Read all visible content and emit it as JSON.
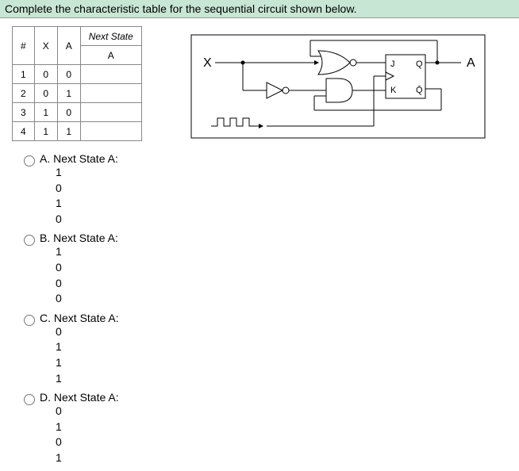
{
  "header": "Complete the characteristic table for the sequential circuit shown below.",
  "table": {
    "h_num": "#",
    "h_x": "X",
    "h_a": "A",
    "h_next_top": "Next State",
    "h_next_sub": "A",
    "rows": [
      {
        "n": "1",
        "x": "0",
        "a": "0",
        "next": ""
      },
      {
        "n": "2",
        "x": "0",
        "a": "1",
        "next": ""
      },
      {
        "n": "3",
        "x": "1",
        "a": "0",
        "next": ""
      },
      {
        "n": "4",
        "x": "1",
        "a": "1",
        "next": ""
      }
    ]
  },
  "circuit": {
    "X": "X",
    "A": "A",
    "J": "J",
    "Q": "Q",
    "K": "K",
    "Qb": "Q̄"
  },
  "options": {
    "a": {
      "label": "A. Next State A:",
      "v0": "1",
      "v1": "0",
      "v2": "1",
      "v3": "0"
    },
    "b": {
      "label": "B. Next State A:",
      "v0": "1",
      "v1": "0",
      "v2": "0",
      "v3": "0"
    },
    "c": {
      "label": "C. Next State A:",
      "v0": "0",
      "v1": "1",
      "v2": "1",
      "v3": "1"
    },
    "d": {
      "label": "D. Next State A:",
      "v0": "0",
      "v1": "1",
      "v2": "0",
      "v3": "1"
    }
  }
}
